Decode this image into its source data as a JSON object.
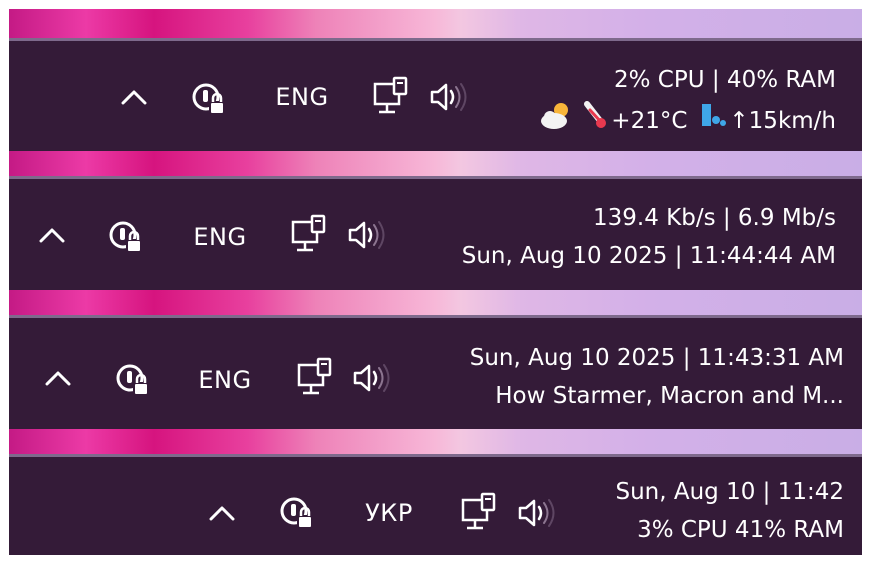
{
  "bars": [
    {
      "language": "ENG",
      "line1": "2% CPU | 40% RAM",
      "temperature": "+21°C",
      "wind": "↑15km/h",
      "icons": [
        "chevron-up-icon",
        "vpn-lock-icon",
        "network-icon",
        "speaker-icon",
        "partly-cloudy-icon",
        "thermometer-icon",
        "wind-icon"
      ]
    },
    {
      "language": "ENG",
      "line1": "139.4 Kb/s | 6.9 Mb/s",
      "line2": "Sun, Aug 10 2025 | 11:44:44 AM"
    },
    {
      "language": "ENG",
      "line1": "Sun, Aug 10 2025 | 11:43:31 AM",
      "line2": "How Starmer, Macron and M..."
    },
    {
      "language": "УКР",
      "line1": "Sun, Aug 10 | 11:42",
      "line2": "3% CPU 41% RAM"
    }
  ],
  "colors": {
    "taskbar_bg": "#341b38",
    "text": "#ffffff",
    "wallpaper_magenta": "#d6147f",
    "wallpaper_lilac": "#d3b0e8"
  }
}
